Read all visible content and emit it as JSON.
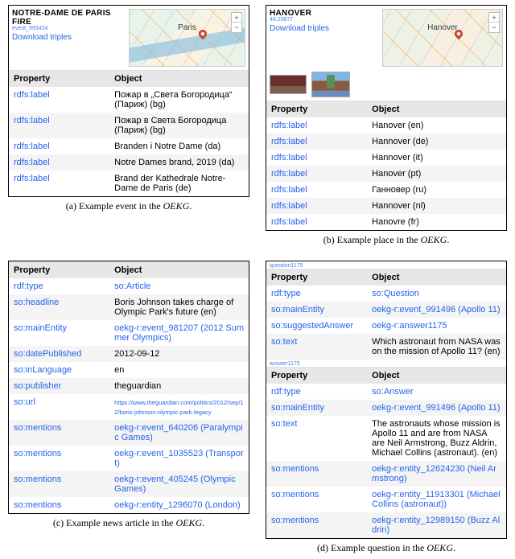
{
  "common": {
    "download": "Download triples",
    "property_header": "Property",
    "object_header": "Object"
  },
  "panel_a": {
    "title": "NOTRE-DAME DE PARIS FIRE",
    "subtitle": "event_993424",
    "map_label": "Paris",
    "rows": [
      {
        "prop": "rdfs:label",
        "prop_link": true,
        "obj": "Пожар в „Света Богородица“ (Париж) (bg)"
      },
      {
        "prop": "rdfs:label",
        "prop_link": true,
        "obj": "Пожар в Света Богородица (Париж) (bg)"
      },
      {
        "prop": "rdfs:label",
        "prop_link": true,
        "obj": "Branden i Notre Dame (da)"
      },
      {
        "prop": "rdfs:label",
        "prop_link": true,
        "obj": "Notre Dames brand, 2019 (da)"
      },
      {
        "prop": "rdfs:label",
        "prop_link": true,
        "obj": "Brand der Kathedrale Notre-Dame de Paris (de)"
      }
    ],
    "caption_a": "(a) Example event in the ",
    "caption_b": "OEKG",
    "caption_c": "."
  },
  "panel_b": {
    "title": "HANOVER",
    "subtitle": "46.20877",
    "map_label": "Hanover",
    "rows": [
      {
        "prop": "rdfs:label",
        "prop_link": true,
        "obj": "Hanover (en)"
      },
      {
        "prop": "rdfs:label",
        "prop_link": true,
        "obj": "Hannover (de)"
      },
      {
        "prop": "rdfs:label",
        "prop_link": true,
        "obj": "Hannover (it)"
      },
      {
        "prop": "rdfs:label",
        "prop_link": true,
        "obj": "Hanover (pt)"
      },
      {
        "prop": "rdfs:label",
        "prop_link": true,
        "obj": "Ганновер (ru)"
      },
      {
        "prop": "rdfs:label",
        "prop_link": true,
        "obj": "Hannover (nl)"
      },
      {
        "prop": "rdfs:label",
        "prop_link": true,
        "obj": "Hanovre (fr)"
      }
    ],
    "caption_a": "(b) Example place in the ",
    "caption_b": "OEKG",
    "caption_c": "."
  },
  "panel_c": {
    "rows": [
      {
        "prop": "rdf:type",
        "prop_link": true,
        "obj": "so:Article",
        "obj_link": true
      },
      {
        "prop": "so:headline",
        "prop_link": true,
        "obj": "Boris Johnson takes charge of Olympic Park's future (en)"
      },
      {
        "prop": "so:mainEntity",
        "prop_link": true,
        "obj": "oekg-r:event_981207 (2012 Summer Olympics)",
        "obj_link": true
      },
      {
        "prop": "so:datePublished",
        "prop_link": true,
        "obj": "2012-09-12"
      },
      {
        "prop": "so:inLanguage",
        "prop_link": true,
        "obj": "en"
      },
      {
        "prop": "so:publisher",
        "prop_link": true,
        "obj": "theguardian"
      },
      {
        "prop": "so:url",
        "prop_link": true,
        "obj": "https://www.theguardian.com/politics/2012/sep/12/boris-johnson-olympic-park-legacy",
        "obj_tiny": true
      },
      {
        "prop": "so:mentions",
        "prop_link": true,
        "obj": "oekg-r:event_640206 (Paralympic Games)",
        "obj_link": true
      },
      {
        "prop": "so:mentions",
        "prop_link": true,
        "obj": "oekg-r:event_1035523 (Transport)",
        "obj_link": true
      },
      {
        "prop": "so:mentions",
        "prop_link": true,
        "obj": "oekg-r:event_405245 (Olympic Games)",
        "obj_link": true
      },
      {
        "prop": "so:mentions",
        "prop_link": true,
        "obj": "oekg-r:entity_1296070 (London)",
        "obj_link": true
      }
    ],
    "caption_a": "(c) Example news article in the ",
    "caption_b": "OEKG",
    "caption_c": "."
  },
  "panel_d": {
    "sub_q": "question1175",
    "sub_a": "answer1175",
    "rows_q": [
      {
        "prop": "rdf:type",
        "prop_link": true,
        "obj": "so:Question",
        "obj_link": true
      },
      {
        "prop": "so:mainEntity",
        "prop_link": true,
        "obj": "oekg-r:event_991496 (Apollo 11)",
        "obj_link": true
      },
      {
        "prop": "so:suggestedAnswer",
        "prop_link": true,
        "obj": "oekg-r:answer1175",
        "obj_link": true
      },
      {
        "prop": "so:text",
        "prop_link": true,
        "obj": "Which astronaut from NASA was on the mission of Apollo 11? (en)"
      }
    ],
    "rows_a": [
      {
        "prop": "rdf:type",
        "prop_link": true,
        "obj": "so:Answer",
        "obj_link": true
      },
      {
        "prop": "so:mainEntity",
        "prop_link": true,
        "obj": "oekg-r:event_991496 (Apollo 11)",
        "obj_link": true
      },
      {
        "prop": "so:text",
        "prop_link": true,
        "obj": "The astronauts whose mission is Apollo 11 and are from NASA are Neil Armstrong, Buzz Aldrin, Michael Collins (astronaut). (en)"
      },
      {
        "prop": "so:mentions",
        "prop_link": true,
        "obj": "oekg-r:entity_12624230 (Neil Armstrong)",
        "obj_link": true
      },
      {
        "prop": "so:mentions",
        "prop_link": true,
        "obj": "oekg-r:entity_11913301 (Michael Collins (astronaut))",
        "obj_link": true
      },
      {
        "prop": "so:mentions",
        "prop_link": true,
        "obj": "oekg-r:entity_12989150 (Buzz Aldrin)",
        "obj_link": true
      }
    ],
    "caption_a": "(d) Example question in the ",
    "caption_b": "OEKG",
    "caption_c": "."
  }
}
